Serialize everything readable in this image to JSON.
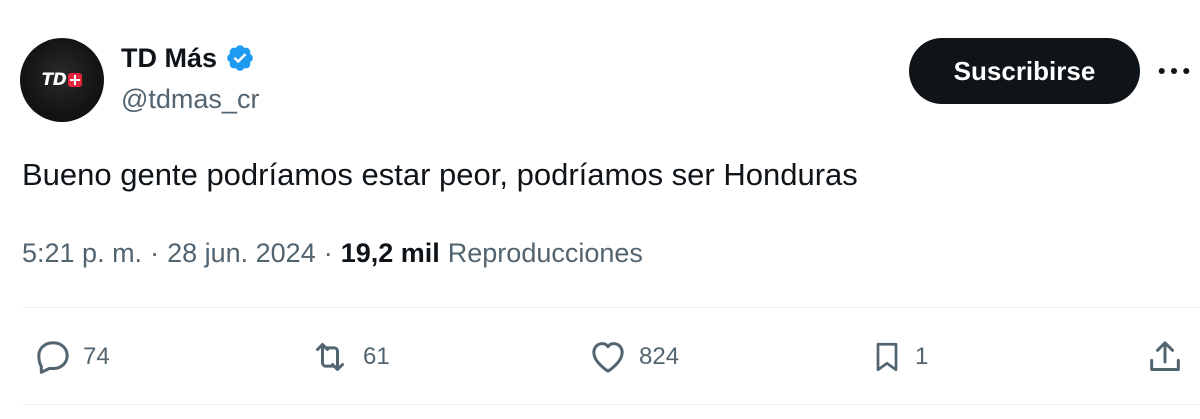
{
  "author": {
    "display_name": "TD Más",
    "handle": "@tdmas_cr",
    "avatar_text": "TD",
    "verified": true,
    "verified_color": "#1d9bf0"
  },
  "header": {
    "subscribe_label": "Suscribirse",
    "more_icon": "more-horizontal-icon"
  },
  "tweet": {
    "text": "Bueno gente podríamos estar peor, podríamos ser Honduras",
    "time": "5:21 p. m.",
    "separator": "·",
    "date": "28 jun. 2024",
    "views_count": "19,2 mil",
    "views_label": "Reproducciones"
  },
  "actions": {
    "reply": {
      "icon": "reply-icon",
      "count": "74"
    },
    "retweet": {
      "icon": "retweet-icon",
      "count": "61"
    },
    "like": {
      "icon": "heart-icon",
      "count": "824"
    },
    "bookmark": {
      "icon": "bookmark-icon",
      "count": "1"
    },
    "share": {
      "icon": "share-icon"
    }
  },
  "colors": {
    "text_primary": "#0f1419",
    "text_secondary": "#536471",
    "button_bg": "#0f1419",
    "divider": "#eff3f4"
  }
}
